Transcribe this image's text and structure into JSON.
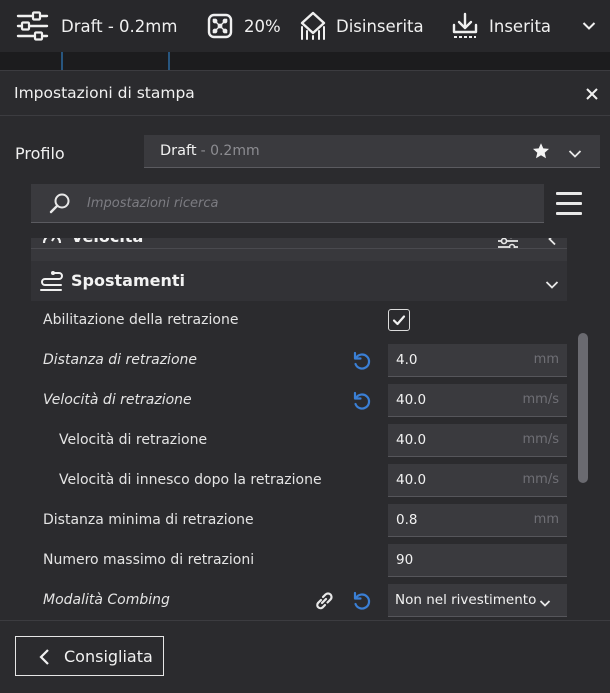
{
  "topbar": {
    "profile_summary": "Draft - 0.2mm",
    "infill": "20%",
    "support": "Disinserita",
    "adhesion": "Inserita"
  },
  "panel": {
    "title": "Impostazioni di stampa",
    "profile_label": "Profilo",
    "profile_name": "Draft",
    "profile_sub": "- 0.2mm",
    "search_placeholder": "Impostazioni ricerca",
    "categories": {
      "speed": "Velocità",
      "travel": "Spostamenti"
    },
    "settings": [
      {
        "label": "Abilitazione della retrazione",
        "type": "checkbox",
        "checked": true
      },
      {
        "label": "Distanza di retrazione",
        "value": "4.0",
        "unit": "mm"
      },
      {
        "label": "Velocità di retrazione",
        "value": "40.0",
        "unit": "mm/s"
      },
      {
        "label": "Velocità di retrazione",
        "value": "40.0",
        "unit": "mm/s"
      },
      {
        "label": "Velocità di innesco dopo la retrazione",
        "value": "40.0",
        "unit": "mm/s"
      },
      {
        "label": "Distanza minima di retrazione",
        "value": "0.8",
        "unit": "mm"
      },
      {
        "label": "Numero massimo di retrazioni",
        "value": "90",
        "unit": ""
      },
      {
        "label": "Modalità Combing",
        "value": "Non nel rivestimento",
        "unit": ""
      }
    ],
    "recommended_label": "Consigliata"
  },
  "colors": {
    "accent": "#3a7fd5",
    "panel_bg": "#2b2b2e",
    "field_bg": "#3a3a3e"
  }
}
